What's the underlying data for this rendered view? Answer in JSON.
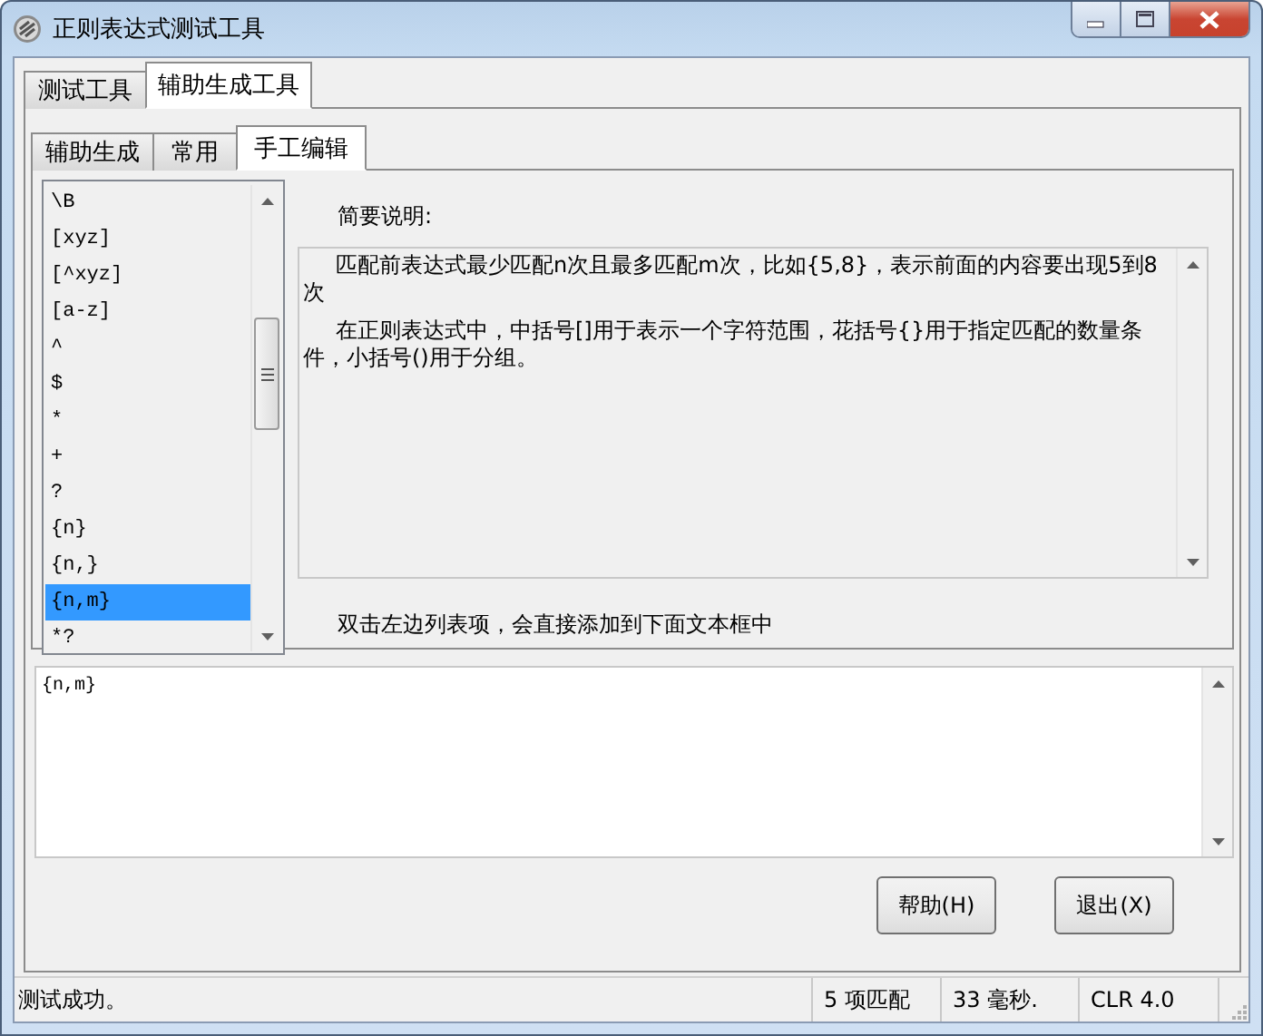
{
  "window": {
    "title": "正则表达式测试工具"
  },
  "tabs": [
    {
      "label": "测试工具",
      "selected": false
    },
    {
      "label": "辅助生成工具",
      "selected": true
    }
  ],
  "sub_tabs": [
    {
      "label": "辅助生成",
      "selected": false
    },
    {
      "label": "常用",
      "selected": false
    },
    {
      "label": "手工编辑",
      "selected": true
    }
  ],
  "token_list": [
    {
      "label": "\\B",
      "selected": false
    },
    {
      "label": "[xyz]",
      "selected": false
    },
    {
      "label": "[^xyz]",
      "selected": false
    },
    {
      "label": "[a-z]",
      "selected": false
    },
    {
      "label": "^",
      "selected": false
    },
    {
      "label": "$",
      "selected": false
    },
    {
      "label": "*",
      "selected": false
    },
    {
      "label": "+",
      "selected": false
    },
    {
      "label": "?",
      "selected": false
    },
    {
      "label": "{n}",
      "selected": false
    },
    {
      "label": "{n,}",
      "selected": false
    },
    {
      "label": "{n,m}",
      "selected": true
    },
    {
      "label": "*?",
      "selected": false
    }
  ],
  "description": {
    "heading": "简要说明:",
    "paragraphs": [
      "匹配前表达式最少匹配n次且最多匹配m次，比如{5,8}，表示前面的内容要出现5到8次",
      "在正则表达式中，中括号[]用于表示一个字符范围，花括号{}用于指定匹配的数量条件，小括号()用于分组。"
    ]
  },
  "hint": "双击左边列表项，会直接添加到下面文本框中",
  "editor": {
    "value": "{n,m}"
  },
  "buttons": [
    {
      "label": "帮助(H)"
    },
    {
      "label": "退出(X)"
    }
  ],
  "status_bar": {
    "message": "测试成功。",
    "matches": "5 项匹配",
    "time": "33 毫秒.",
    "runtime": "CLR 4.0"
  }
}
